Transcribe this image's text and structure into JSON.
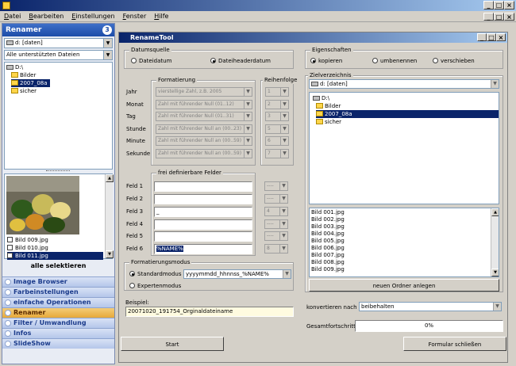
{
  "window": {
    "title": ""
  },
  "menu": [
    "Datei",
    "Bearbeiten",
    "Einstellungen",
    "Fenster",
    "Hilfe"
  ],
  "sidebar": {
    "title": "Renamer",
    "badge": "3",
    "drive": "d: [daten]",
    "filter": "Alle unterstützten Dateien",
    "tree": [
      {
        "label": "D:\\",
        "type": "drive"
      },
      {
        "label": "Bilder",
        "type": "folder"
      },
      {
        "label": "2007_08a",
        "type": "folder",
        "selected": true
      },
      {
        "label": "sicher",
        "type": "folder"
      }
    ],
    "files": [
      {
        "label": "Bild 009.jpg",
        "selected": false
      },
      {
        "label": "Bild 010.jpg",
        "selected": false
      },
      {
        "label": "Bild 011.jpg",
        "selected": true
      }
    ],
    "select_all": "alle selektieren",
    "sections": [
      "Image Browser",
      "Farbeinstellungen",
      "einfache Operationen",
      "Renamer",
      "Filter / Umwandlung",
      "Infos",
      "SlideShow"
    ],
    "active_section": "Renamer"
  },
  "dialog": {
    "title": "RenameTool",
    "datumsquelle": {
      "label": "Datumsquelle",
      "options": [
        "Dateidatum",
        "Dateiheaderdatum"
      ],
      "selected": "Dateiheaderdatum"
    },
    "formatierung": {
      "label": "Formatierung",
      "rows": [
        {
          "label": "Jahr",
          "value": "vierstellige Zahl, z.B. 2005"
        },
        {
          "label": "Monat",
          "value": "Zahl mit führender Null (01..12)"
        },
        {
          "label": "Tag",
          "value": "Zahl mit führender Null (01..31)"
        },
        {
          "label": "Stunde",
          "value": "Zahl mit führender Null an (00..23)"
        },
        {
          "label": "Minute",
          "value": "Zahl mit führender Null an (00..59)"
        },
        {
          "label": "Sekunde",
          "value": "Zahl mit führender Null an (00..59)"
        }
      ]
    },
    "reihenfolge": {
      "label": "Reihenfolge",
      "values": [
        "1",
        "2",
        "3",
        "5",
        "6",
        "7"
      ]
    },
    "freie_felder": {
      "label": "frei definierbare Felder",
      "rows": [
        {
          "label": "Feld 1",
          "value": "",
          "order": "----"
        },
        {
          "label": "Feld 2",
          "value": "",
          "order": "----"
        },
        {
          "label": "Feld 3",
          "value": "_",
          "order": "4"
        },
        {
          "label": "Feld 4",
          "value": "",
          "order": "----"
        },
        {
          "label": "Feld 5",
          "value": "",
          "order": "----"
        },
        {
          "label": "Feld 6",
          "value": "%NAME%",
          "order": "8"
        }
      ]
    },
    "formatierungsmodus": {
      "label": "Formatierungsmodus",
      "options": [
        "Standardmodus",
        "Expertenmodus"
      ],
      "selected": "Standardmodus",
      "pattern": "yyyymmdd_hhnnss_%NAME%"
    },
    "beispiel": {
      "label": "Beispiel:",
      "value": "20071020_191754_Orginaldateiname"
    },
    "eigenschaften": {
      "label": "Eigenschaften",
      "options": [
        "kopieren",
        "umbenennen",
        "verschieben"
      ],
      "selected": "kopieren"
    },
    "zielverzeichnis": {
      "label": "Zielverzeichnis",
      "drive": "d: [daten]",
      "tree": [
        {
          "label": "D:\\",
          "type": "drive"
        },
        {
          "label": "Bilder",
          "type": "folder"
        },
        {
          "label": "2007_08a",
          "type": "folder",
          "selected": true
        },
        {
          "label": "sicher",
          "type": "folder"
        }
      ]
    },
    "files": [
      "Bild 001.jpg",
      "Bild 002.jpg",
      "Bild 003.jpg",
      "Bild 004.jpg",
      "Bild 005.jpg",
      "Bild 006.jpg",
      "Bild 007.jpg",
      "Bild 008.jpg",
      "Bild 009.jpg"
    ],
    "new_folder_button": "neuen Ordner anlegen",
    "konvertieren": {
      "label": "konvertieren nach :",
      "value": "beibehalten"
    },
    "gesamtfortschritt": {
      "label": "Gesamtfortschritt",
      "value": "0%",
      "progress": 0
    },
    "start_button": "Start",
    "close_button": "Formular schließen"
  },
  "colors": {
    "titlebar": "#0a246a",
    "selection": "#0a246a",
    "active_section": "#e6a83a"
  }
}
